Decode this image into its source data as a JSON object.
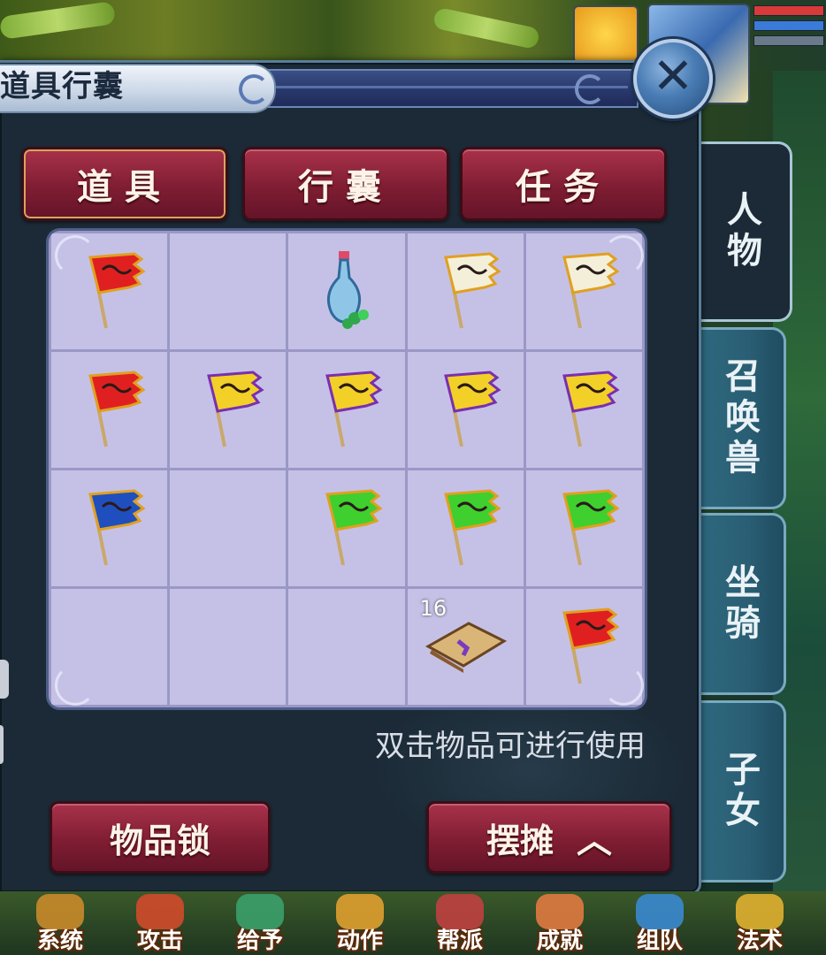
{
  "window": {
    "title": "道具行囊",
    "close_label": "✕"
  },
  "top_tabs": [
    {
      "label": "道具",
      "active": true
    },
    {
      "label": "行囊",
      "active": false
    },
    {
      "label": "任务",
      "active": false
    }
  ],
  "side_tabs": [
    {
      "label": "人物",
      "active": true
    },
    {
      "label": "召唤兽",
      "active": false
    },
    {
      "label": "坐骑",
      "active": false
    },
    {
      "label": "子女",
      "active": false
    }
  ],
  "inventory": {
    "slots": [
      {
        "item": "red-flag-icon",
        "count": ""
      },
      {
        "item": "",
        "count": ""
      },
      {
        "item": "blue-vase-icon",
        "count": ""
      },
      {
        "item": "white-flag-icon",
        "count": ""
      },
      {
        "item": "white-flag-icon",
        "count": ""
      },
      {
        "item": "red-flag-icon",
        "count": ""
      },
      {
        "item": "yellow-flag-icon",
        "count": ""
      },
      {
        "item": "yellow-flag-icon",
        "count": ""
      },
      {
        "item": "yellow-flag-icon",
        "count": ""
      },
      {
        "item": "yellow-flag-icon",
        "count": ""
      },
      {
        "item": "blue-flag-icon",
        "count": ""
      },
      {
        "item": "",
        "count": ""
      },
      {
        "item": "green-flag-icon",
        "count": ""
      },
      {
        "item": "green-flag-icon",
        "count": ""
      },
      {
        "item": "green-flag-icon",
        "count": ""
      },
      {
        "item": "",
        "count": ""
      },
      {
        "item": "",
        "count": ""
      },
      {
        "item": "",
        "count": ""
      },
      {
        "item": "scroll-icon",
        "count": "16"
      },
      {
        "item": "red-flag-icon",
        "count": ""
      }
    ]
  },
  "hint": "双击物品可进行使用",
  "buttons": {
    "lock_label": "物品锁",
    "stall_label": "摆摊",
    "stall_chevron": "︿"
  },
  "bottom_menu": [
    {
      "label": "系统",
      "icon": "scroll-menu-icon"
    },
    {
      "label": "攻击",
      "icon": "sword-menu-icon"
    },
    {
      "label": "给予",
      "icon": "give-menu-icon"
    },
    {
      "label": "动作",
      "icon": "action-menu-icon"
    },
    {
      "label": "帮派",
      "icon": "guild-menu-icon"
    },
    {
      "label": "成就",
      "icon": "achievement-menu-icon"
    },
    {
      "label": "组队",
      "icon": "team-menu-icon"
    },
    {
      "label": "法术",
      "icon": "magic-menu-icon"
    }
  ],
  "colors": {
    "red_flag": "#e02020",
    "yellow_flag": "#f2d028",
    "white_flag": "#f4efd8",
    "green_flag": "#3fcf2e",
    "blue_flag": "#1f4fbf",
    "flag_trim_gold": "#e0a020",
    "flag_trim_purple": "#7a2fb0"
  }
}
